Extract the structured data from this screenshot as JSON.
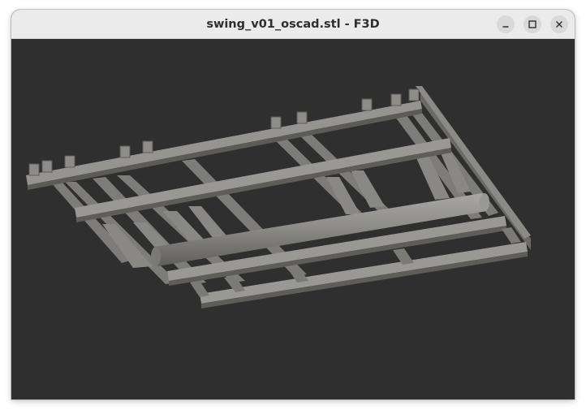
{
  "window": {
    "title": "swing_v01_oscad.stl - F3D"
  },
  "titlebar_buttons": {
    "minimize_icon": "minimize-icon",
    "maximize_icon": "maximize-icon",
    "close_icon": "close-icon"
  },
  "viewport": {
    "background_color": "#2f2f2f",
    "model_color": "#8a8884"
  }
}
